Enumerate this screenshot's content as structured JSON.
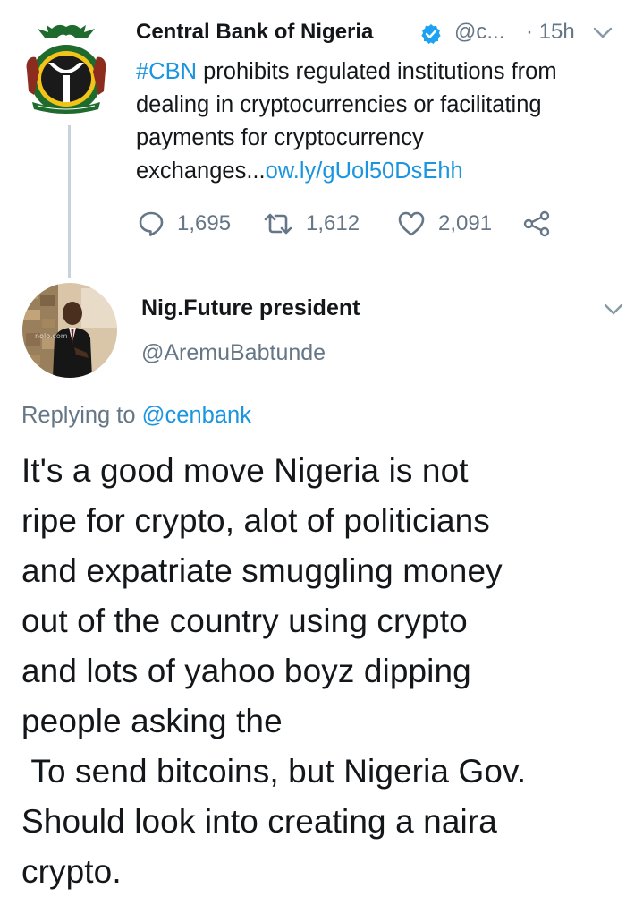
{
  "parent_tweet": {
    "author_name": "Central Bank of Nigeria",
    "handle": "@c...",
    "time": "· 15h",
    "hashtag": "#CBN",
    "text": " prohibits regulated institutions from dealing in cryptocurrencies or facilitating payments for cryptocurrency exchanges...",
    "link": "ow.ly/gUol50DsEhh",
    "replies": "1,695",
    "retweets": "1,612",
    "likes": "2,091"
  },
  "reply_tweet": {
    "author_name": "Nig.Future president",
    "handle": "@AremuBabtunde",
    "replying_prefix": "Replying to ",
    "replying_to": "@cenbank",
    "text": "It's a good move Nigeria is not\nripe for crypto, alot of politicians\nand expatriate smuggling money\nout of the country using crypto\nand lots of yahoo boyz dipping\npeople asking the\n To send bitcoins, but Nigeria Gov.\nShould look into creating a naira\ncrypto."
  },
  "colors": {
    "link": "#1b95e0",
    "secondary_text": "#657786",
    "primary_text": "#14171a",
    "thread_line": "#c8d2da"
  },
  "icons": [
    "cbn-logo",
    "verified-badge-icon",
    "chevron-down-icon",
    "reply-icon",
    "retweet-icon",
    "like-icon",
    "share-icon"
  ]
}
